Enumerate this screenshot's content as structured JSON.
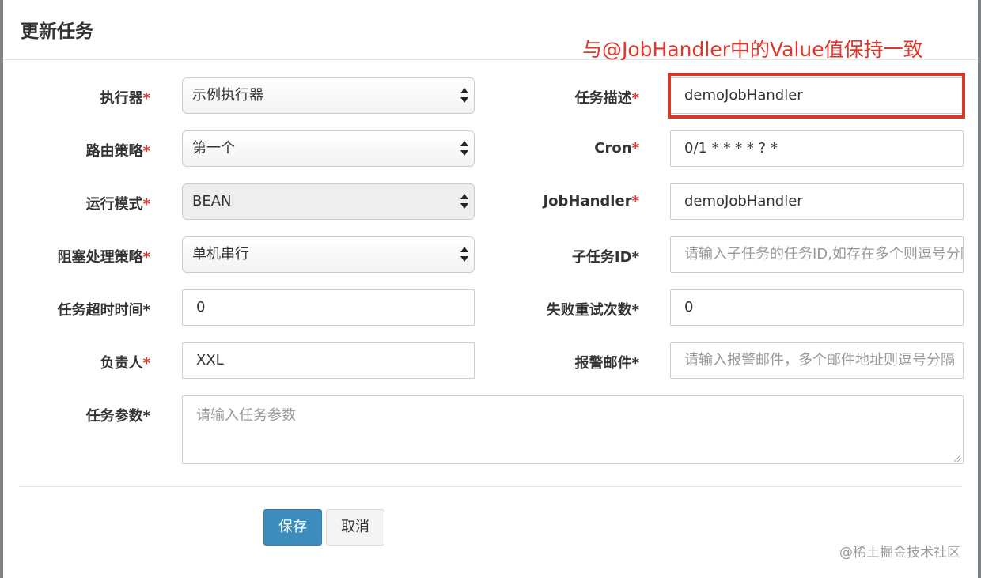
{
  "dialog": {
    "title": "更新任务",
    "annotation": "与@JobHandler中的Value值保持一致"
  },
  "left_fields": [
    {
      "label": "执行器",
      "value": "示例执行器",
      "kind": "select"
    },
    {
      "label": "路由策略",
      "value": "第一个",
      "kind": "select"
    },
    {
      "label": "运行模式",
      "value": "BEAN",
      "kind": "select-disabled"
    },
    {
      "label": "阻塞处理策略",
      "value": "单机串行",
      "kind": "select"
    },
    {
      "label": "任务超时时间",
      "value": "0",
      "kind": "input"
    },
    {
      "label": "负责人",
      "value": "XXL",
      "kind": "input"
    }
  ],
  "right_fields": [
    {
      "label": "任务描述",
      "value": "demoJobHandler",
      "kind": "input"
    },
    {
      "label": "Cron",
      "value": "0/1 * * * * ? *",
      "kind": "input"
    },
    {
      "label": "JobHandler",
      "value": "demoJobHandler",
      "kind": "input"
    },
    {
      "label": "子任务ID",
      "placeholder": "请输入子任务的任务ID,如存在多个则逗号分隔",
      "kind": "input"
    },
    {
      "label": "失败重试次数",
      "value": "0",
      "kind": "input"
    },
    {
      "label": "报警邮件",
      "placeholder": "请输入报警邮件，多个邮件地址则逗号分隔",
      "kind": "input"
    }
  ],
  "params": {
    "label": "任务参数",
    "placeholder": "请输入任务参数"
  },
  "required_mark": "*",
  "buttons": {
    "save": "保存",
    "cancel": "取消"
  },
  "watermark": "@稀土掘金技术社区",
  "colors": {
    "primary": "#3c8dbc",
    "required": "#e0362a",
    "highlight": "#d43a2a"
  }
}
